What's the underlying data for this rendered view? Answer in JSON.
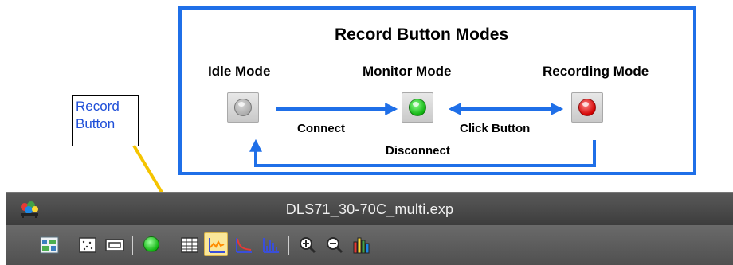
{
  "annotation": {
    "title": "Record Button Modes",
    "modes": [
      {
        "label": "Idle Mode",
        "led": "grey"
      },
      {
        "label": "Monitor Mode",
        "led": "green"
      },
      {
        "label": "Recording Mode",
        "led": "red"
      }
    ],
    "transitions": {
      "connect": "Connect",
      "click_button": "Click Button",
      "disconnect": "Disconnect"
    },
    "callout_line1": "Record",
    "callout_line2": "Button",
    "colors": {
      "box_border": "#1f6fe8",
      "arrow": "#1f6fe8",
      "pointer": "#f5c400",
      "callout_text": "#1f4fd8"
    }
  },
  "window": {
    "title": "DLS71_30-70C_multi.exp",
    "toolbar": [
      {
        "name": "sample-setup-icon"
      },
      {
        "name": "separator"
      },
      {
        "name": "scatter-view-icon"
      },
      {
        "name": "window-view-icon"
      },
      {
        "name": "separator"
      },
      {
        "name": "record-icon",
        "state": "monitor"
      },
      {
        "name": "separator"
      },
      {
        "name": "table-icon"
      },
      {
        "name": "correlogram-icon",
        "active": true
      },
      {
        "name": "decay-chart-icon"
      },
      {
        "name": "histogram-icon"
      },
      {
        "name": "separator"
      },
      {
        "name": "zoom-in-icon"
      },
      {
        "name": "zoom-out-icon"
      },
      {
        "name": "color-bars-icon"
      }
    ]
  }
}
